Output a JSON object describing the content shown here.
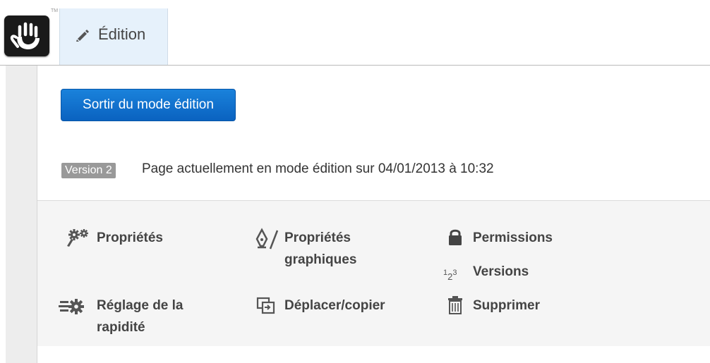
{
  "toolbar": {
    "trademark": "TM",
    "tab_label": "Édition"
  },
  "panel": {
    "exit_button_label": "Sortir du mode édition",
    "version_badge": "Version 2",
    "status_text": "Page actuellement en mode édition sur 04/01/2013 à 10:32"
  },
  "actions": {
    "properties": "Propriétés",
    "design_line1": "Propriétés",
    "design_line2": "graphiques",
    "permissions": "Permissions",
    "versions_icon": {
      "a": "1",
      "b": "2",
      "c": "3"
    },
    "versions": "Versions",
    "speed_line1": "Réglage de la",
    "speed_line2": "rapidité",
    "move_copy": "Déplacer/copier",
    "delete": "Supprimer"
  },
  "colors": {
    "primary_button": "#0a62c0",
    "active_tab": "#e6f1fb",
    "badge": "#999999"
  }
}
